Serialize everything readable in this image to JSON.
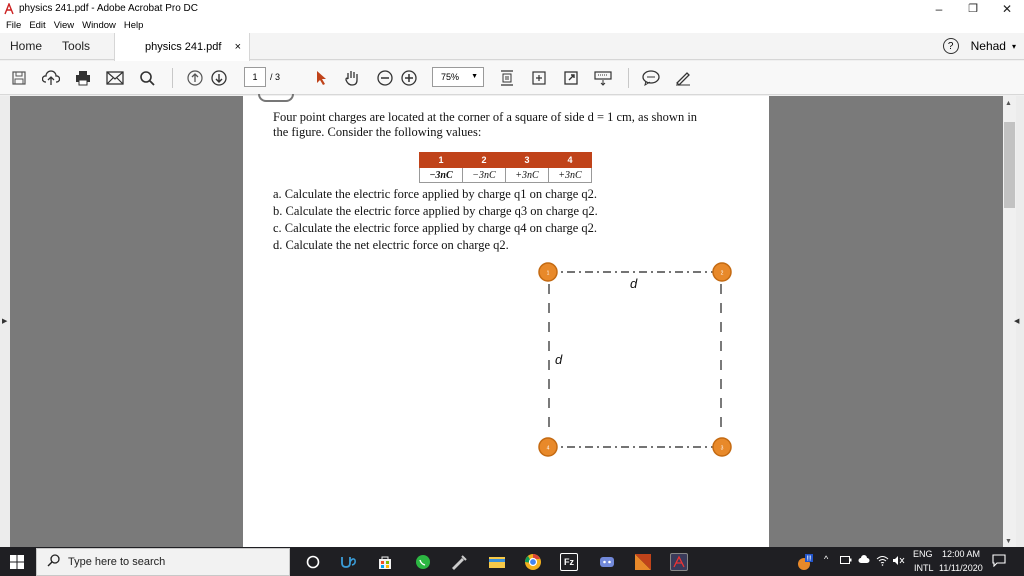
{
  "window": {
    "title": "physics 241.pdf - Adobe Acrobat Pro DC",
    "minimize": "–",
    "maximize": "❐",
    "close": "✕"
  },
  "menu": [
    "File",
    "Edit",
    "View",
    "Window",
    "Help"
  ],
  "tabs": {
    "home": "Home",
    "tools": "Tools",
    "document": "physics 241.pdf",
    "close": "×",
    "help": "?",
    "user": "Nehad",
    "user_caret": "▾"
  },
  "toolbar": {
    "icons": [
      "save-icon",
      "upload-cloud-icon",
      "print-icon",
      "email-icon",
      "search-icon",
      "page-up-icon",
      "page-down-icon",
      "select-arrow-icon",
      "hand-tool-icon",
      "zoom-out-icon",
      "zoom-in-icon",
      "fit-page-icon",
      "rotate-icon",
      "fullscreen-icon",
      "keyboard-icon",
      "comment-icon",
      "pen-icon"
    ],
    "current_page": "1",
    "total_pages": "/ 3",
    "zoom": "75%"
  },
  "document": {
    "problem_line1": "Four point charges are located at the corner of a square of side d = 1 cm, as shown in",
    "problem_line2": "the figure. Consider the following values:",
    "table": {
      "headers": [
        "1",
        "2",
        "3",
        "4"
      ],
      "values": [
        "−3nC",
        "−3nC",
        "+3nC",
        "+3nC"
      ]
    },
    "questions": [
      "a. Calculate the electric force applied by charge q1 on charge q2.",
      "b. Calculate the electric force applied by charge q3 on charge q2.",
      "c. Calculate the electric force applied by charge q4 on charge q2.",
      "d. Calculate the net electric force on charge q2."
    ],
    "figure": {
      "side_label_top": "d",
      "side_label_left": "d",
      "charge_labels": [
        "1",
        "2",
        "4",
        "3"
      ],
      "charge_color": "#e8892a"
    }
  },
  "taskbar": {
    "search_placeholder": "Type here to search",
    "lang": "ENG",
    "region": "INTL",
    "time": "12:00 AM",
    "date": "11/11/2020"
  },
  "colors": {
    "accent": "#c0431a",
    "taskbar": "#1f1f23",
    "doc_bg": "#7a7a7a"
  }
}
